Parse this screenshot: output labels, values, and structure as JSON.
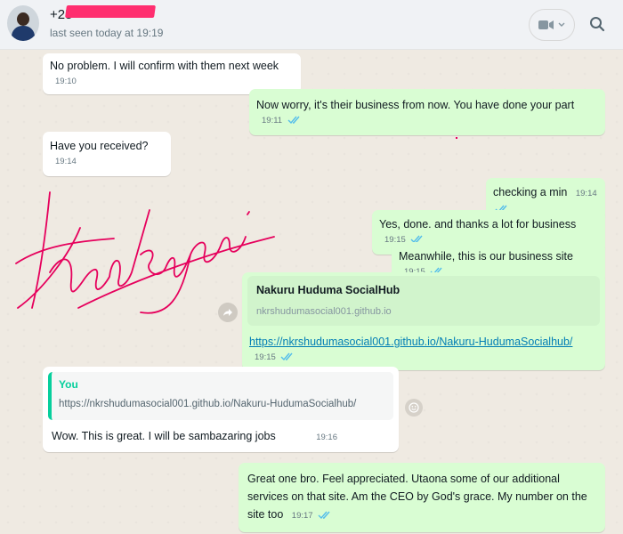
{
  "header": {
    "contact_name": "+25",
    "last_seen": "last seen today at 19:19",
    "icons": {
      "video": "video-call-icon",
      "dropdown": "chevron-down-icon",
      "search": "search-icon",
      "avatar": "avatar"
    }
  },
  "annotation": {
    "text": "thank you."
  },
  "messages": [
    {
      "dir": "in",
      "text": "No problem. I will confirm with them next week",
      "time": "19:10"
    },
    {
      "dir": "out",
      "text": "Now worry, it's their business from now. You have done your part",
      "time": "19:11"
    },
    {
      "dir": "in",
      "text": "Have you received?",
      "time": "19:14"
    },
    {
      "dir": "out",
      "text": "checking a min",
      "time": "19:14"
    },
    {
      "dir": "out",
      "text": "Yes, done. and thanks a lot for business",
      "time": "19:15"
    },
    {
      "dir": "out",
      "text": "Meanwhile, this is our business site",
      "time": "19:15"
    },
    {
      "dir": "out",
      "preview_title": "Nakuru Huduma SocialHub",
      "preview_domain": "nkrshudumasocial001.github.io",
      "link": "https://nkrshudumasocial001.github.io/Nakuru-HudumaSocialhub/",
      "time": "19:15"
    },
    {
      "dir": "in",
      "quote_author": "You",
      "quote_text": "https://nkrshudumasocial001.github.io/Nakuru-HudumaSocialhub/",
      "text": "Wow. This is great. I will be sambazaring jobs",
      "time": "19:16"
    },
    {
      "dir": "out",
      "text": "Great one bro. Feel appreciated. Utaona some of our additional services on that site. Am the CEO by God's grace. My number on the site too",
      "time": "19:17"
    }
  ],
  "colors": {
    "incoming": "#ffffff",
    "outgoing": "#d9fdd3",
    "read_ticks": "#53bdeb",
    "handwriting": "#e6005c"
  }
}
